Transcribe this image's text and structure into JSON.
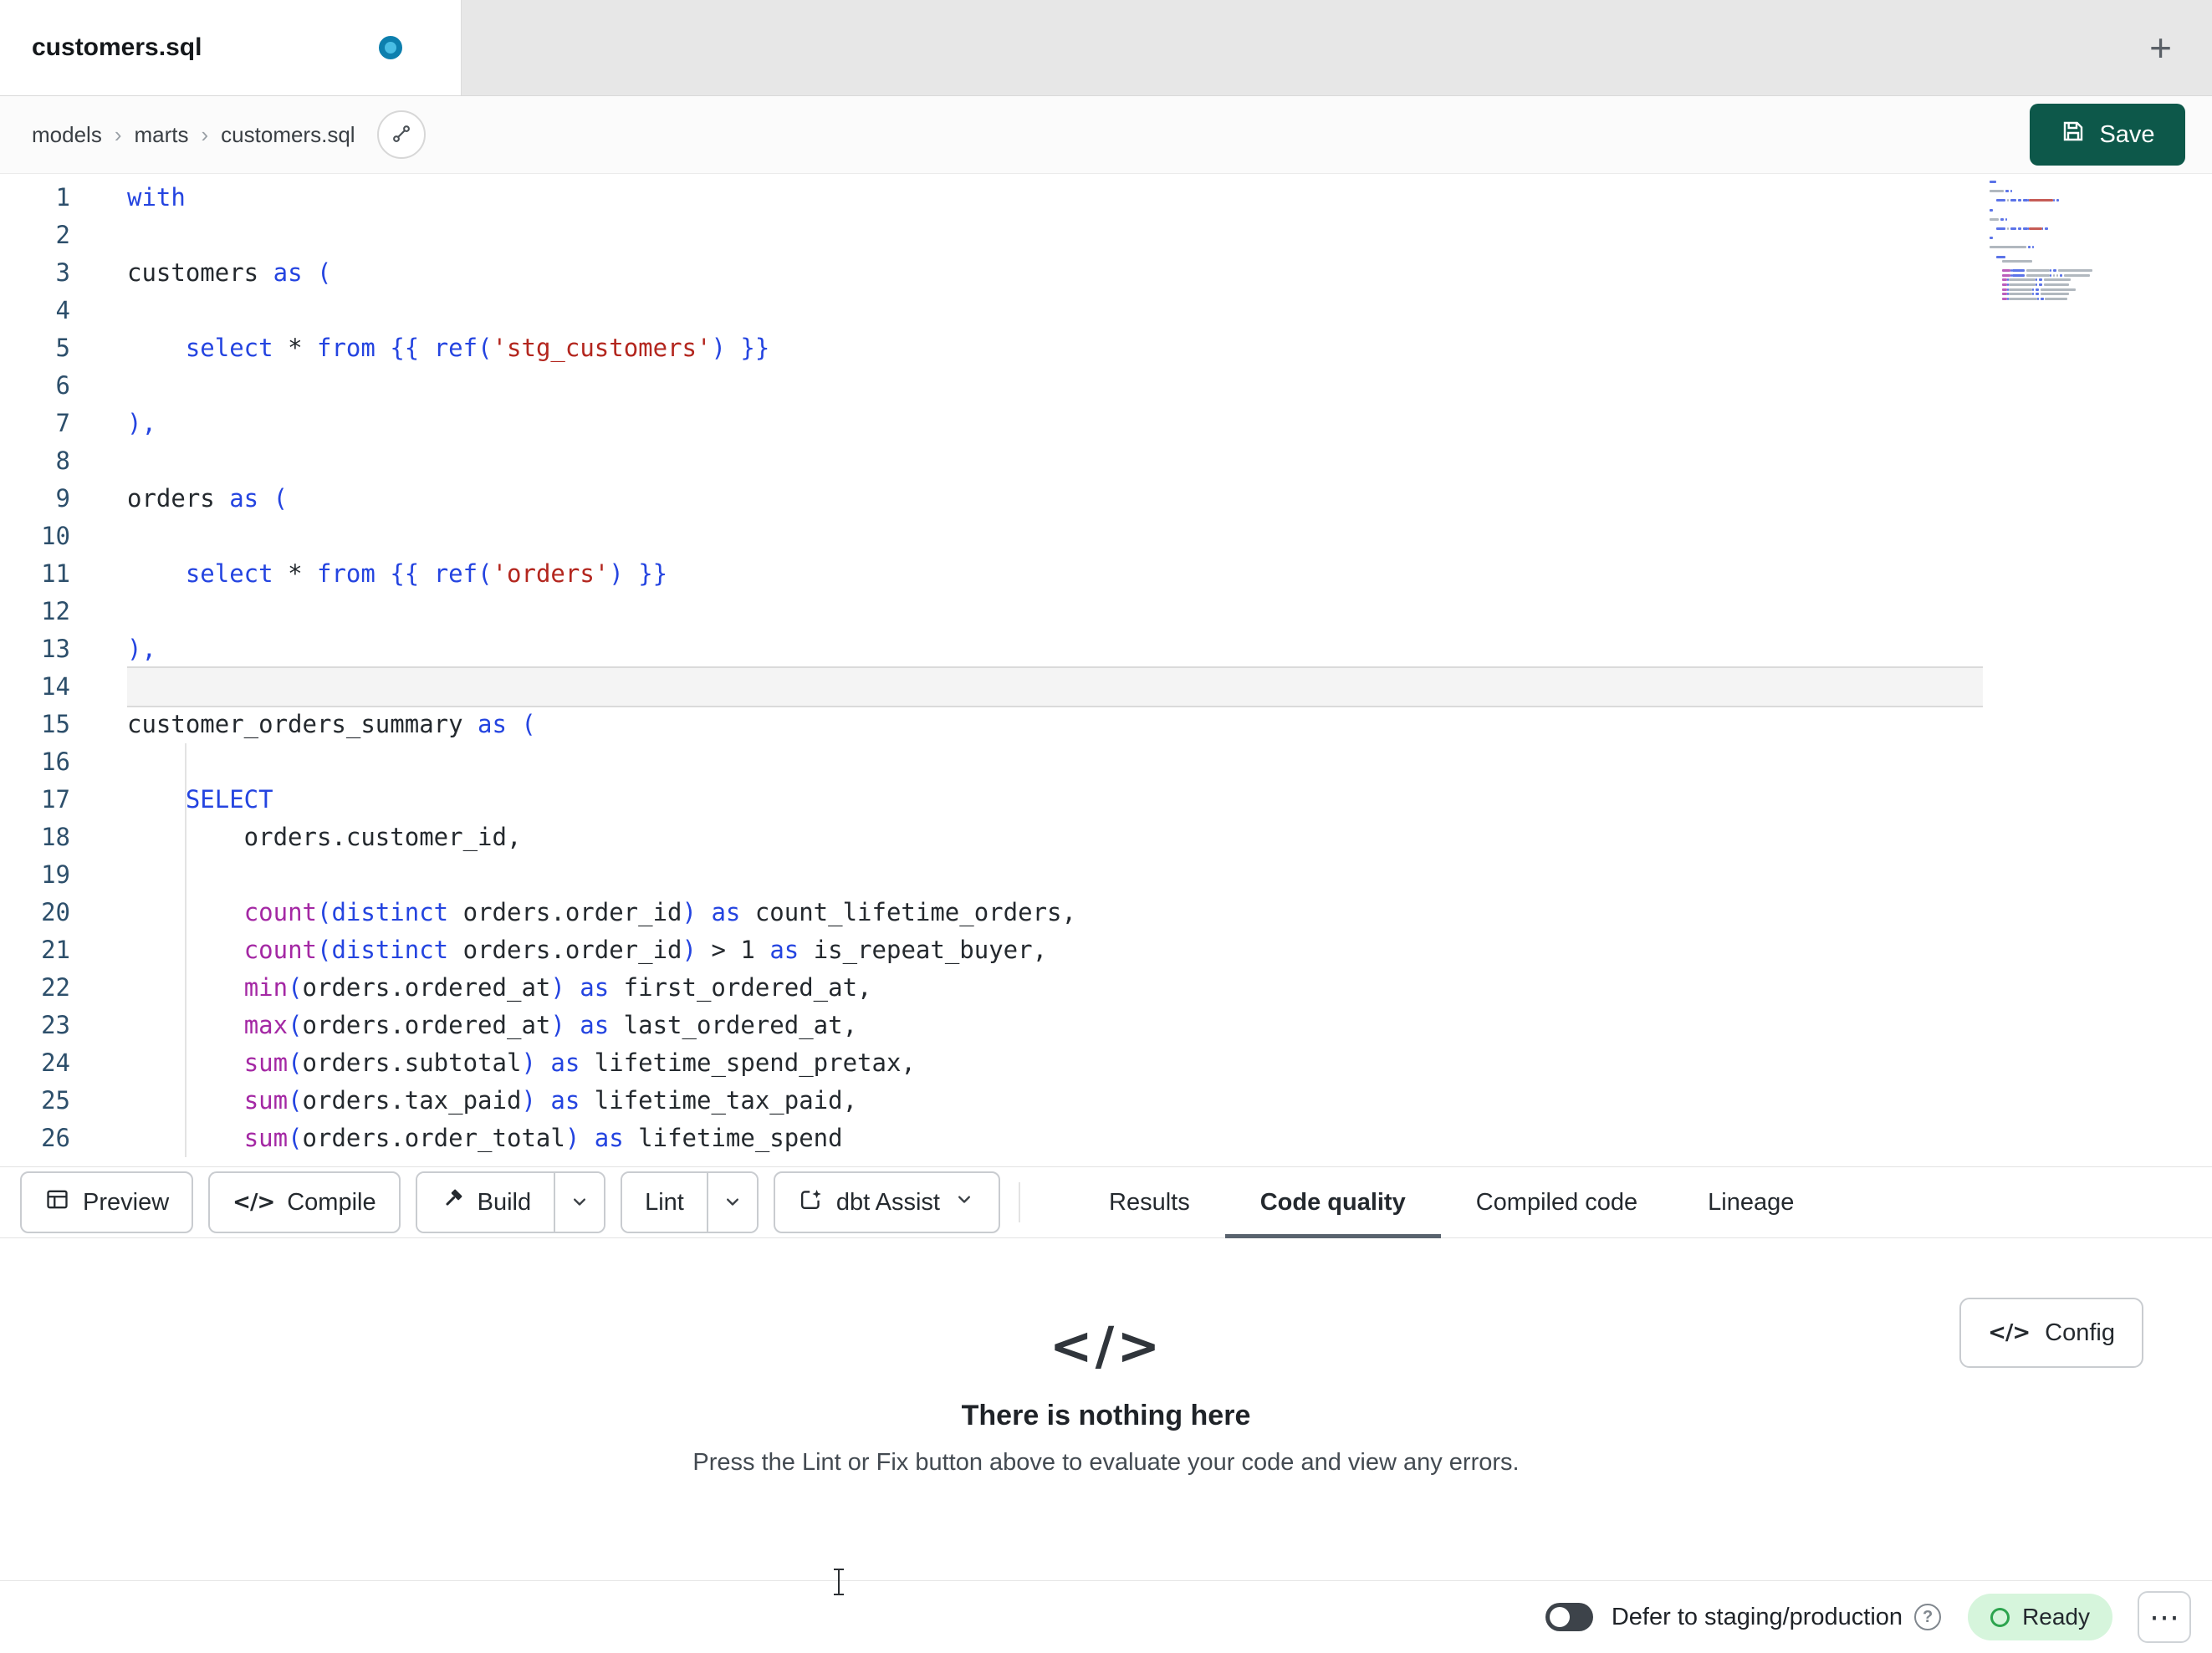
{
  "tab_bar": {
    "active_tab": "customers.sql"
  },
  "icons": {
    "code_glyph": "</>",
    "plus": "+",
    "more": "⋯",
    "help": "?"
  },
  "breadcrumb": {
    "items": [
      "models",
      "marts",
      "customers.sql"
    ],
    "separator": "›"
  },
  "file_header": {
    "save_label": "Save"
  },
  "editor": {
    "current_line": 14,
    "lines": [
      {
        "n": 1,
        "t": [
          [
            "kw",
            "with"
          ]
        ]
      },
      {
        "n": 2,
        "t": []
      },
      {
        "n": 3,
        "t": [
          [
            "txt",
            "customers "
          ],
          [
            "kw",
            "as"
          ],
          [
            "txt",
            " "
          ],
          [
            "br",
            "("
          ]
        ]
      },
      {
        "n": 4,
        "t": []
      },
      {
        "n": 5,
        "t": [
          [
            "txt",
            "    "
          ],
          [
            "kw",
            "select"
          ],
          [
            "txt",
            " * "
          ],
          [
            "kw",
            "from"
          ],
          [
            "txt",
            " "
          ],
          [
            "br",
            "{{"
          ],
          [
            "txt",
            " "
          ],
          [
            "kw",
            "ref"
          ],
          [
            "br",
            "("
          ],
          [
            "str",
            "'stg_customers'"
          ],
          [
            "br",
            ")"
          ],
          [
            "txt",
            " "
          ],
          [
            "br",
            "}}"
          ]
        ]
      },
      {
        "n": 6,
        "t": []
      },
      {
        "n": 7,
        "t": [
          [
            "br",
            "),"
          ]
        ]
      },
      {
        "n": 8,
        "t": []
      },
      {
        "n": 9,
        "t": [
          [
            "txt",
            "orders "
          ],
          [
            "kw",
            "as"
          ],
          [
            "txt",
            " "
          ],
          [
            "br",
            "("
          ]
        ]
      },
      {
        "n": 10,
        "t": []
      },
      {
        "n": 11,
        "t": [
          [
            "txt",
            "    "
          ],
          [
            "kw",
            "select"
          ],
          [
            "txt",
            " * "
          ],
          [
            "kw",
            "from"
          ],
          [
            "txt",
            " "
          ],
          [
            "br",
            "{{"
          ],
          [
            "txt",
            " "
          ],
          [
            "kw",
            "ref"
          ],
          [
            "br",
            "("
          ],
          [
            "str",
            "'orders'"
          ],
          [
            "br",
            ")"
          ],
          [
            "txt",
            " "
          ],
          [
            "br",
            "}}"
          ]
        ]
      },
      {
        "n": 12,
        "t": []
      },
      {
        "n": 13,
        "t": [
          [
            "br",
            "),"
          ]
        ]
      },
      {
        "n": 14,
        "t": []
      },
      {
        "n": 15,
        "t": [
          [
            "txt",
            "customer_orders_summary "
          ],
          [
            "kw",
            "as"
          ],
          [
            "txt",
            " "
          ],
          [
            "br",
            "("
          ]
        ]
      },
      {
        "n": 16,
        "t": [],
        "g": true
      },
      {
        "n": 17,
        "t": [
          [
            "txt",
            "    "
          ],
          [
            "kw",
            "SELECT"
          ]
        ],
        "g": true
      },
      {
        "n": 18,
        "t": [
          [
            "txt",
            "        orders.customer_id,"
          ]
        ],
        "g": true
      },
      {
        "n": 19,
        "t": [],
        "g": true
      },
      {
        "n": 20,
        "t": [
          [
            "txt",
            "        "
          ],
          [
            "fn",
            "count"
          ],
          [
            "br",
            "("
          ],
          [
            "kw",
            "distinct"
          ],
          [
            "txt",
            " orders.order_id"
          ],
          [
            "br",
            ")"
          ],
          [
            "txt",
            " "
          ],
          [
            "kw",
            "as"
          ],
          [
            "txt",
            " count_lifetime_orders,"
          ]
        ],
        "g": true
      },
      {
        "n": 21,
        "t": [
          [
            "txt",
            "        "
          ],
          [
            "fn",
            "count"
          ],
          [
            "br",
            "("
          ],
          [
            "kw",
            "distinct"
          ],
          [
            "txt",
            " orders.order_id"
          ],
          [
            "br",
            ")"
          ],
          [
            "txt",
            " > "
          ],
          [
            "num",
            "1"
          ],
          [
            "txt",
            " "
          ],
          [
            "kw",
            "as"
          ],
          [
            "txt",
            " is_repeat_buyer,"
          ]
        ],
        "g": true
      },
      {
        "n": 22,
        "t": [
          [
            "txt",
            "        "
          ],
          [
            "fn",
            "min"
          ],
          [
            "br",
            "("
          ],
          [
            "txt",
            "orders.ordered_at"
          ],
          [
            "br",
            ")"
          ],
          [
            "txt",
            " "
          ],
          [
            "kw",
            "as"
          ],
          [
            "txt",
            " first_ordered_at,"
          ]
        ],
        "g": true
      },
      {
        "n": 23,
        "t": [
          [
            "txt",
            "        "
          ],
          [
            "fn",
            "max"
          ],
          [
            "br",
            "("
          ],
          [
            "txt",
            "orders.ordered_at"
          ],
          [
            "br",
            ")"
          ],
          [
            "txt",
            " "
          ],
          [
            "kw",
            "as"
          ],
          [
            "txt",
            " last_ordered_at,"
          ]
        ],
        "g": true
      },
      {
        "n": 24,
        "t": [
          [
            "txt",
            "        "
          ],
          [
            "fn",
            "sum"
          ],
          [
            "br",
            "("
          ],
          [
            "txt",
            "orders.subtotal"
          ],
          [
            "br",
            ")"
          ],
          [
            "txt",
            " "
          ],
          [
            "kw",
            "as"
          ],
          [
            "txt",
            " lifetime_spend_pretax,"
          ]
        ],
        "g": true
      },
      {
        "n": 25,
        "t": [
          [
            "txt",
            "        "
          ],
          [
            "fn",
            "sum"
          ],
          [
            "br",
            "("
          ],
          [
            "txt",
            "orders.tax_paid"
          ],
          [
            "br",
            ")"
          ],
          [
            "txt",
            " "
          ],
          [
            "kw",
            "as"
          ],
          [
            "txt",
            " lifetime_tax_paid,"
          ]
        ],
        "g": true
      },
      {
        "n": 26,
        "t": [
          [
            "txt",
            "        "
          ],
          [
            "fn",
            "sum"
          ],
          [
            "br",
            "("
          ],
          [
            "txt",
            "orders.order_total"
          ],
          [
            "br",
            ")"
          ],
          [
            "txt",
            " "
          ],
          [
            "kw",
            "as"
          ],
          [
            "txt",
            " lifetime_spend"
          ]
        ],
        "g": true
      }
    ]
  },
  "toolbar": {
    "preview_label": "Preview",
    "compile_label": "Compile",
    "build_label": "Build",
    "lint_label": "Lint",
    "assist_label": "dbt Assist"
  },
  "panel_tabs": [
    "Results",
    "Code quality",
    "Compiled code",
    "Lineage"
  ],
  "results_panel": {
    "title": "There is nothing here",
    "description": "Press the Lint or Fix button above to evaluate your code and view any errors.",
    "config_label": "Config"
  },
  "status_bar": {
    "defer_label": "Defer to staging/production",
    "ready_label": "Ready"
  },
  "colors": {
    "keyword": "#2444e0",
    "func": "#a428a4",
    "string": "#b3261e",
    "bracket": "#2444e0",
    "text": "#24292e",
    "number": "#24292e",
    "linenum": "#2d4f6b",
    "save": "#0d584a",
    "readybg": "#d6f5dc",
    "readyring": "#2da44e"
  }
}
